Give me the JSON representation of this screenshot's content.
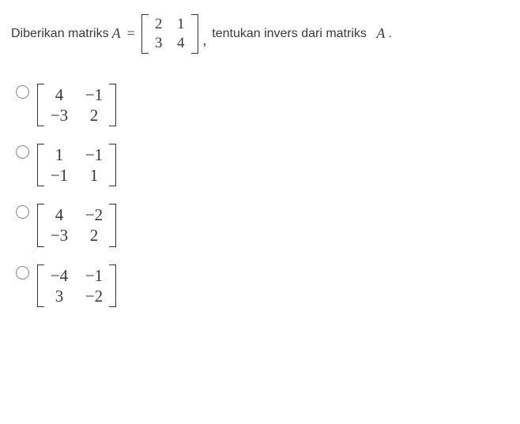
{
  "question": {
    "lead": "Diberikan matriks",
    "var": "A",
    "eq": "=",
    "matrix": {
      "a": "2",
      "b": "1",
      "c": "3",
      "d": "4"
    },
    "tail": "tentukan invers dari matriks",
    "tailVar": "A",
    "period": "."
  },
  "options": [
    {
      "a": "4",
      "b": "−1",
      "c": "−3",
      "d": "2"
    },
    {
      "a": "1",
      "b": "−1",
      "c": "−1",
      "d": "1"
    },
    {
      "a": "4",
      "b": "−2",
      "c": "−3",
      "d": "2"
    },
    {
      "a": "−4",
      "b": "−1",
      "c": "3",
      "d": "−2"
    }
  ]
}
